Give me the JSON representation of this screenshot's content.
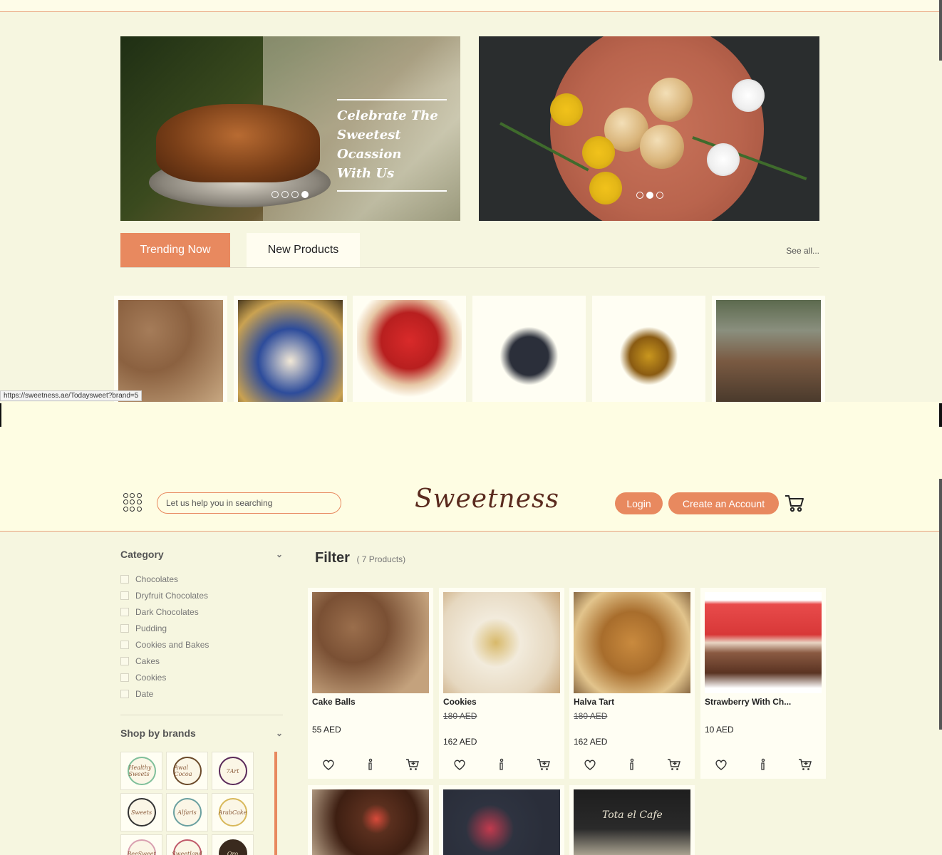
{
  "banner": {
    "left_title_line1": "Celebrate The",
    "left_title_line2": "Sweetest Ocassion",
    "left_title_line3": "With Us"
  },
  "tabs": {
    "trending": "Trending Now",
    "new_products": "New Products",
    "see_all": "See all..."
  },
  "status_bar": {
    "url": "https://sweetness.ae/Todaysweet?brand=5"
  },
  "header": {
    "search_placeholder": "Let us help you in searching",
    "logo": "Sweetness",
    "login": "Login",
    "create_account": "Create an Account"
  },
  "sidebar": {
    "category_title": "Category",
    "categories": [
      "Chocolates",
      "Dryfruit Chocolates",
      "Dark Chocolates",
      "Pudding",
      "Cookies and Bakes",
      "Cakes",
      "Cookies",
      "Date"
    ],
    "brands_title": "Shop by brands",
    "brands": [
      "Healthy Sweets",
      "Awal Cocoa",
      "7Art",
      "Sweets",
      "Alfaris",
      "ArabCake",
      "BeeSweet",
      "Sweetland",
      "Oro"
    ]
  },
  "main": {
    "filter_title": "Filter",
    "filter_count": "( 7 Products)",
    "products": [
      {
        "name": "Cake Balls",
        "old_price": "",
        "price": "55 AED"
      },
      {
        "name": "Cookies",
        "old_price": "180 AED",
        "price": "162 AED"
      },
      {
        "name": "Halva Tart",
        "old_price": "180 AED",
        "price": "162 AED"
      },
      {
        "name": "Strawberry With Ch...",
        "old_price": "",
        "price": "10 AED"
      }
    ],
    "row2_cafe_sign": "Tota el Cafe"
  },
  "colors": {
    "accent": "#e8895f",
    "background": "#f6f6e0",
    "card": "#fffef3",
    "logo": "#5a2a1e"
  },
  "icons": [
    "grid-menu-icon",
    "cart-icon",
    "heart-icon",
    "info-icon",
    "add-to-cart-icon",
    "chevron-down-icon"
  ]
}
